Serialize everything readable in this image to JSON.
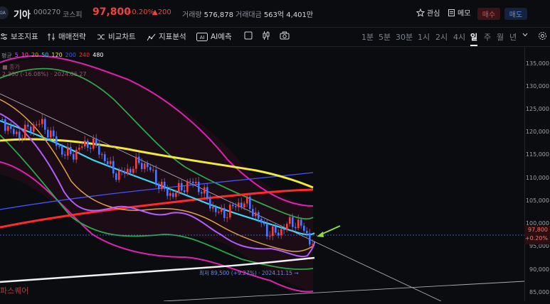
{
  "header": {
    "logo_text": "KIA",
    "stock_name": "기아",
    "stock_code": "000270",
    "market": "코스피",
    "price": "97,800",
    "change_pct": "+0.20%",
    "change_amt": "▲200",
    "volume_label": "거래량",
    "volume_value": "576,878",
    "amount_label": "거래대금",
    "amount_value": "563억 4,401만",
    "favorite_label": "관심",
    "memo_label": "메모",
    "buy_label": "매수",
    "sell_label": "매도"
  },
  "toolbar": {
    "settings_label": "보조지표",
    "strategy_label": "매매전략",
    "compare_label": "비교차트",
    "analysis_label": "지표분석",
    "ai_label": "AI예측",
    "periods": [
      "1분",
      "5분",
      "30분",
      "1시",
      "2시",
      "4시",
      "일",
      "주",
      "월",
      "년"
    ],
    "selected_period": "일"
  },
  "legend": {
    "prefix": "평균",
    "ma": [
      {
        "label": "5",
        "color": "#b45cff"
      },
      {
        "label": "10",
        "color": "#ff4fa8"
      },
      {
        "label": "20",
        "color": "#e0a040"
      },
      {
        "label": "50",
        "color": "#3dd6f5"
      },
      {
        "label": "120",
        "color": "#f2ea3b"
      },
      {
        "label": "200",
        "color": "#4455ff"
      },
      {
        "label": "240",
        "color": "#ff2a2a"
      },
      {
        "label": "480",
        "color": "#ffffff"
      }
    ],
    "line2": "■ 종가",
    "line3": "2,300 (-16.08%) · 2024.06.27"
  },
  "y_axis": {
    "ticks": [
      "135,000",
      "130,000",
      "125,000",
      "120,000",
      "115,000",
      "110,000",
      "105,000",
      "100,000",
      "95,000",
      "90,000",
      "85,000"
    ],
    "current_price": "97,800",
    "current_change": "+0.20%"
  },
  "annotations": {
    "low_label": "최저 89,500 (+9.27%) · 2024.11.15 →"
  },
  "brand_text": "파스퀘어",
  "colors": {
    "up": "#f0433f",
    "down": "#4a78ff",
    "accent_arrow": "#8fd94a"
  }
}
